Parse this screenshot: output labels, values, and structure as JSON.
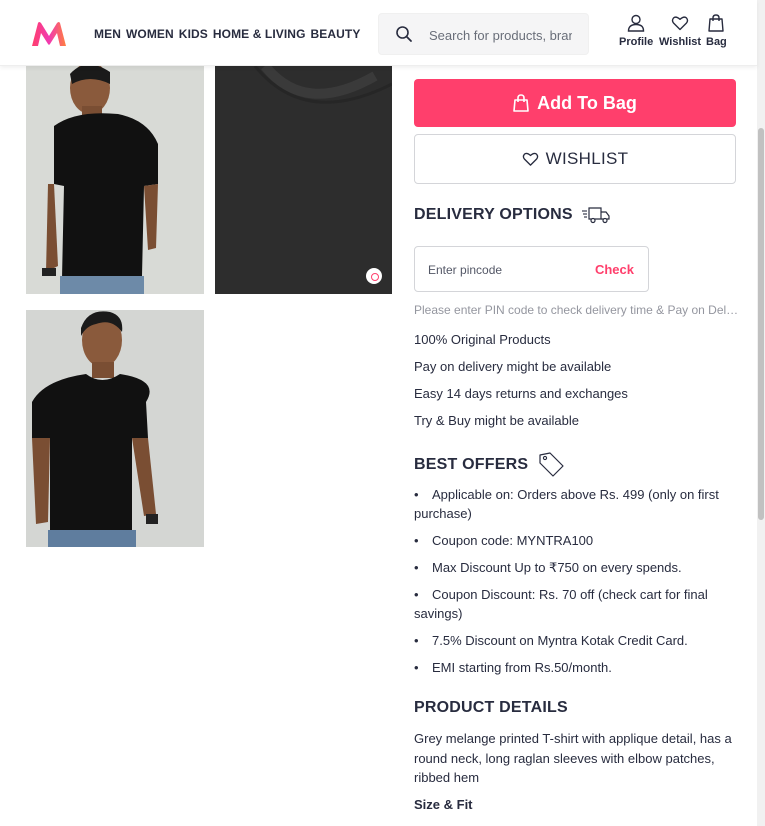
{
  "header": {
    "nav": [
      "MEN",
      "WOMEN",
      "KIDS",
      "HOME & LIVING",
      "BEAUTY"
    ],
    "search_placeholder": "Search for products, brands and more",
    "profile_label": "Profile",
    "wishlist_label": "Wishlist",
    "bag_label": "Bag"
  },
  "actions": {
    "add_to_bag": "Add To Bag",
    "wishlist": "WISHLIST"
  },
  "delivery": {
    "title": "DELIVERY OPTIONS",
    "pincode_placeholder": "Enter pincode",
    "check_label": "Check",
    "hint": "Please enter PIN code to check delivery time & Pay on Delivery Availability",
    "features": [
      "100% Original Products",
      "Pay on delivery might be available",
      "Easy 14 days returns and exchanges",
      "Try & Buy might be available"
    ]
  },
  "offers": {
    "title": "BEST OFFERS",
    "items": [
      "Applicable on: Orders above Rs. 499 (only on first purchase)",
      "Coupon code: MYNTRA100",
      "Max Discount Up to ₹750 on every spends.",
      "Coupon Discount: Rs. 70 off (check cart for final savings)",
      "7.5% Discount on Myntra Kotak Credit Card.",
      "EMI starting from Rs.50/month."
    ]
  },
  "product": {
    "title": "PRODUCT DETAILS",
    "description": "Grey melange printed T-shirt with applique detail, has a round neck, long raglan sleeves with elbow patches, ribbed hem",
    "size_fit_label": "Size & Fit"
  },
  "colors": {
    "accent": "#ff3f6c",
    "text": "#282c3f",
    "muted": "#94969f"
  }
}
